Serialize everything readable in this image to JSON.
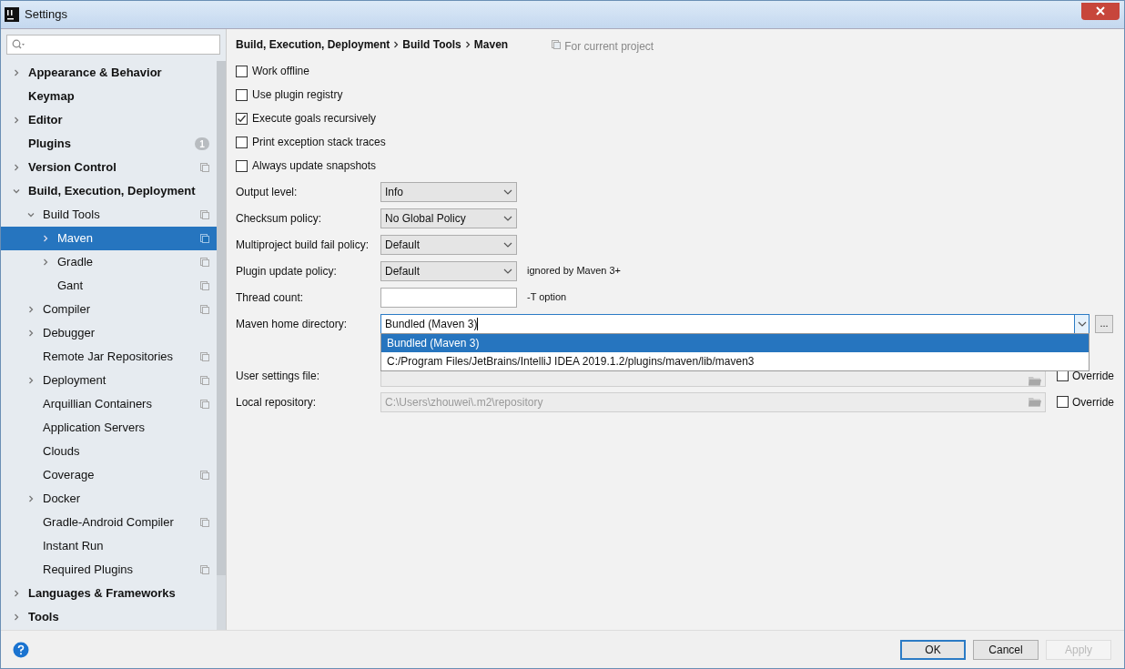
{
  "window": {
    "title": "Settings"
  },
  "tree": [
    {
      "label": "Appearance & Behavior",
      "expanded": false,
      "selected": false
    },
    {
      "label": "Keymap",
      "selected": false
    },
    {
      "label": "Editor",
      "expanded": false,
      "selected": false
    },
    {
      "label": "Plugins",
      "selected": false,
      "badge": "1"
    },
    {
      "label": "Version Control",
      "expanded": false,
      "selected": false,
      "project_scope": true
    },
    {
      "label": "Build, Execution, Deployment",
      "expanded": true,
      "selected": false,
      "children": [
        {
          "label": "Build Tools",
          "expanded": true,
          "selected": false,
          "project_scope": true,
          "children": [
            {
              "label": "Maven",
              "expanded": false,
              "selected": true,
              "project_scope": true
            },
            {
              "label": "Gradle",
              "expanded": false,
              "selected": false,
              "project_scope": true
            },
            {
              "label": "Gant",
              "selected": false,
              "project_scope": true
            }
          ]
        },
        {
          "label": "Compiler",
          "expanded": false,
          "selected": false,
          "project_scope": true
        },
        {
          "label": "Debugger",
          "expanded": false,
          "selected": false
        },
        {
          "label": "Remote Jar Repositories",
          "selected": false,
          "project_scope": true
        },
        {
          "label": "Deployment",
          "expanded": false,
          "selected": false,
          "project_scope": true
        },
        {
          "label": "Arquillian Containers",
          "selected": false,
          "project_scope": true
        },
        {
          "label": "Application Servers",
          "selected": false
        },
        {
          "label": "Clouds",
          "selected": false
        },
        {
          "label": "Coverage",
          "selected": false,
          "project_scope": true
        },
        {
          "label": "Docker",
          "expanded": false,
          "selected": false
        },
        {
          "label": "Gradle-Android Compiler",
          "selected": false,
          "project_scope": true
        },
        {
          "label": "Instant Run",
          "selected": false
        },
        {
          "label": "Required Plugins",
          "selected": false,
          "project_scope": true
        }
      ]
    },
    {
      "label": "Languages & Frameworks",
      "expanded": false,
      "selected": false
    },
    {
      "label": "Tools",
      "expanded": false,
      "selected": false
    }
  ],
  "breadcrumb": [
    "Build, Execution, Deployment",
    "Build Tools",
    "Maven"
  ],
  "scope_note": "For current project",
  "checkboxes": [
    {
      "label": "Work offline",
      "checked": false
    },
    {
      "label": "Use plugin registry",
      "checked": false
    },
    {
      "label": "Execute goals recursively",
      "checked": true
    },
    {
      "label": "Print exception stack traces",
      "checked": false
    },
    {
      "label": "Always update snapshots",
      "checked": false
    }
  ],
  "fields": [
    {
      "kind": "select",
      "label": "Output level:",
      "value": "Info"
    },
    {
      "kind": "select",
      "label": "Checksum policy:",
      "value": "No Global Policy"
    },
    {
      "kind": "select",
      "label": "Multiproject build fail policy:",
      "value": "Default"
    },
    {
      "kind": "select",
      "label": "Plugin update policy:",
      "value": "Default",
      "note": "ignored by Maven 3+"
    },
    {
      "kind": "text",
      "label": "Thread count:",
      "note": "-T option"
    }
  ],
  "maven_home": {
    "label": "Maven home directory:",
    "value": "Bundled (Maven 3)",
    "browse": "...",
    "options": [
      {
        "label": "Bundled (Maven 3)",
        "selected": true
      },
      {
        "label": "C:/Program Files/JetBrains/IntelliJ IDEA 2019.1.2/plugins/maven/lib/maven3",
        "selected": false
      }
    ]
  },
  "paths": [
    {
      "label": "User settings file:",
      "disabled": true,
      "override": "Override",
      "checked": false
    },
    {
      "label": "Local repository:",
      "value": "C:\\Users\\zhouwei\\.m2\\repository",
      "disabled": true,
      "override": "Override",
      "checked": false
    }
  ],
  "buttons": [
    {
      "label": "OK",
      "default": true,
      "disabled": false
    },
    {
      "label": "Cancel",
      "default": false,
      "disabled": false
    },
    {
      "label": "Apply",
      "default": false,
      "disabled": true
    }
  ]
}
